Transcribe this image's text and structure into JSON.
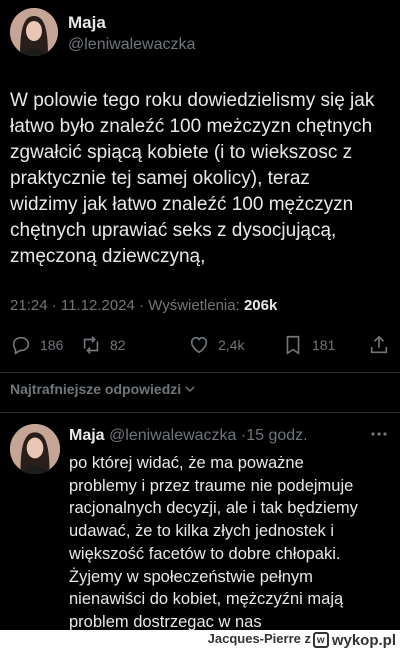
{
  "post": {
    "author_name": "Maja",
    "author_handle": "@leniwalewaczka",
    "text": "W polowie tego roku dowiedzielismy się jak\nłatwo było znaleźć 100 meżczyzn chętnych\nzgwałcić spiącą kobiete (i to wiekszosc z\npraktycznie tej samej okolicy), teraz\nwidzimy jak łatwo znaleźć 100 mężczyzn\nchętnych uprawiać seks z dysocjującą,\nzmęczoną dziewczyną,",
    "time": "21:24",
    "date": "11.12.2024",
    "views_label": "Wyświetlenia:",
    "views_count": "206k",
    "replies": "186",
    "reposts": "82",
    "likes": "2,4k",
    "bookmarks": "181"
  },
  "sort": {
    "label": "Najtrafniejsze odpowiedzi"
  },
  "reply": {
    "author_name": "Maja",
    "author_handle": "@leniwalewaczka",
    "time_ago": "15 godz.",
    "text": "po której widać, że ma poważne\nproblemy i przez traume nie podejmuje\nracjonalnych decyzji, ale i tak będziemy\nudawać, że to kilka złych jednostek i\nwiększość facetów to dobre chłopaki.\nŻyjemy w społeczeństwie pełnym\nnienawiści do kobiet, mężczyźni mają\nproblem dostrzegac w nas"
  },
  "footer": {
    "uploader": "Jacques-Pierre",
    "uploader_suffix": "z",
    "site": "wykop.pl"
  },
  "colors": {
    "background": "#000000",
    "text": "#e7e9ea",
    "muted": "#71767b",
    "divider": "#2f3336"
  },
  "icons": [
    "reply-icon",
    "repost-icon",
    "like-icon",
    "bookmark-icon",
    "share-icon",
    "chevron-down-icon",
    "more-icon"
  ]
}
